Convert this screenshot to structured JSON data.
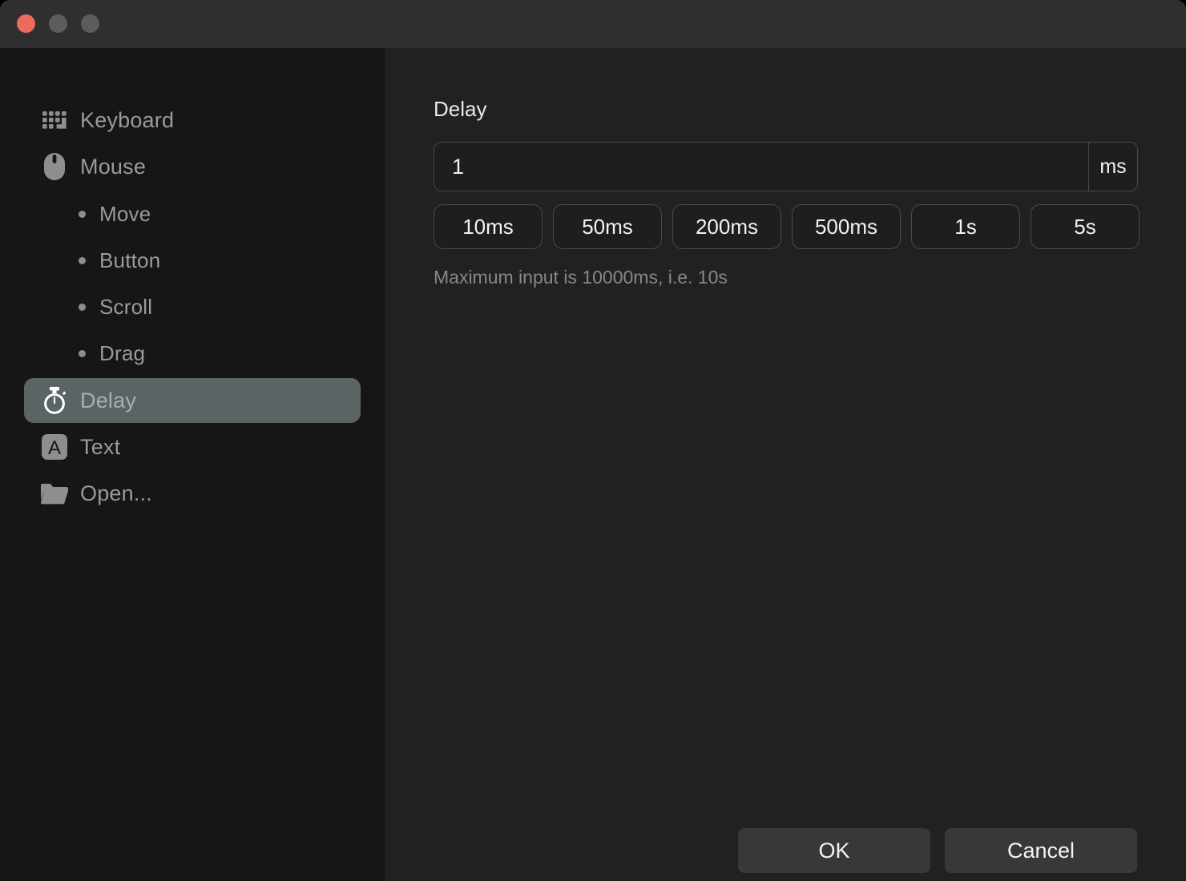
{
  "window": {
    "titlebar": {
      "controls": [
        {
          "name": "close",
          "label": "Close",
          "color": "#ec6a5e"
        },
        {
          "name": "minimize",
          "label": "Minimize",
          "color": "#5c5c5c"
        },
        {
          "name": "maximize",
          "label": "Maximize",
          "color": "#5c5c5c"
        }
      ]
    },
    "background": "#212121",
    "sidebar_background": "#161616",
    "selected_background": "#5a6465"
  },
  "sidebar": {
    "items": [
      {
        "label": "Keyboard",
        "icon": "keyboard-icon",
        "selected": false,
        "sub": false
      },
      {
        "label": "Mouse",
        "icon": "mouse-icon",
        "selected": false,
        "sub": false
      },
      {
        "label": "Move",
        "icon": "bullet-icon",
        "selected": false,
        "sub": true
      },
      {
        "label": "Button",
        "icon": "bullet-icon",
        "selected": false,
        "sub": true
      },
      {
        "label": "Scroll",
        "icon": "bullet-icon",
        "selected": false,
        "sub": true
      },
      {
        "label": "Drag",
        "icon": "bullet-icon",
        "selected": false,
        "sub": true
      },
      {
        "label": "Delay",
        "icon": "stopwatch-icon",
        "selected": true,
        "sub": false
      },
      {
        "label": "Text",
        "icon": "text-a-icon",
        "selected": false,
        "sub": false
      },
      {
        "label": "Open...",
        "icon": "folder-icon",
        "selected": false,
        "sub": false
      }
    ]
  },
  "main": {
    "section_title": "Delay",
    "delay_input": {
      "value": "1",
      "placeholder": "",
      "suffix": "ms"
    },
    "presets": [
      {
        "label": "10ms"
      },
      {
        "label": "50ms"
      },
      {
        "label": "200ms"
      },
      {
        "label": "500ms"
      },
      {
        "label": "1s"
      },
      {
        "label": "5s"
      }
    ],
    "hint": "Maximum input is 10000ms, i.e. 10s"
  },
  "footer": {
    "ok_label": "OK",
    "cancel_label": "Cancel"
  }
}
